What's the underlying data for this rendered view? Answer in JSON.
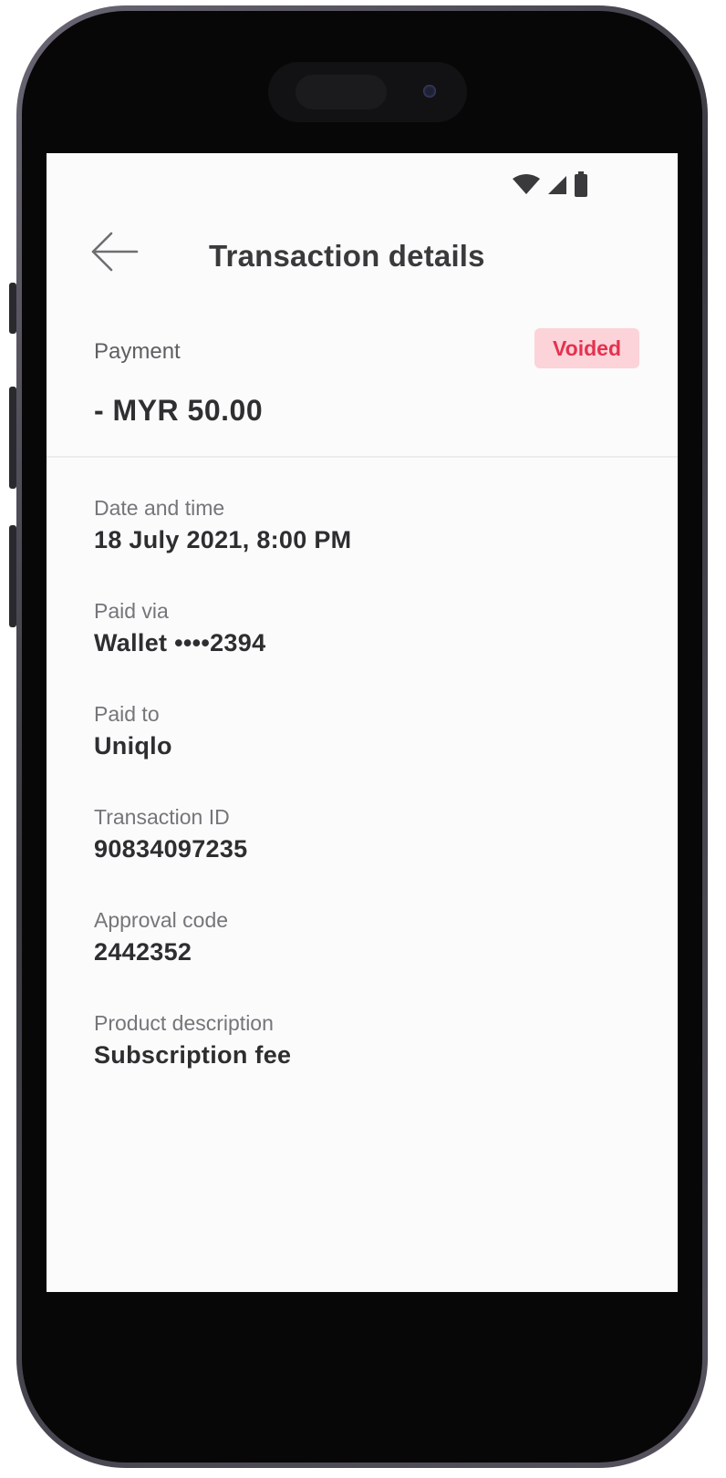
{
  "header": {
    "title": "Transaction details"
  },
  "summary": {
    "type_label": "Payment",
    "status": "Voided",
    "amount": "- MYR 50.00"
  },
  "details": [
    {
      "label": "Date and time",
      "value": "18 July 2021, 8:00 PM"
    },
    {
      "label": "Paid via",
      "value": "Wallet ••••2394"
    },
    {
      "label": "Paid to",
      "value": "Uniqlo"
    },
    {
      "label": "Transaction ID",
      "value": "90834097235"
    },
    {
      "label": "Approval code",
      "value": "2442352"
    },
    {
      "label": "Product description",
      "value": "Subscription fee"
    }
  ],
  "icons": {
    "back": "arrow-left-icon",
    "wifi": "wifi-icon",
    "signal": "cellular-signal-icon",
    "battery": "battery-icon"
  },
  "colors": {
    "badge_background": "#fbd3d9",
    "badge_text": "#e5314f",
    "screen_background": "#fbfbfb",
    "frame": "#070707"
  }
}
